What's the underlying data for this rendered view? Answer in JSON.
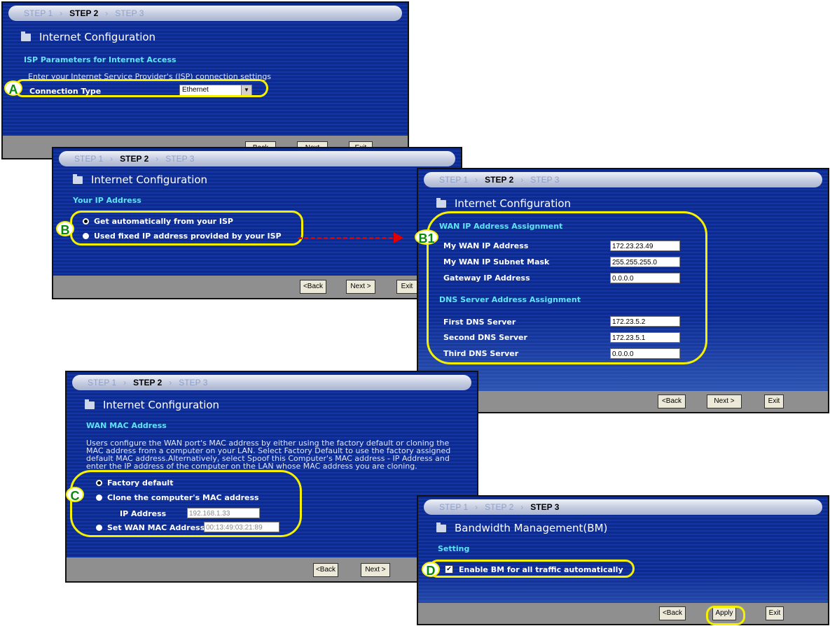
{
  "panel_a": {
    "steps": [
      "STEP 1",
      "STEP 2",
      "STEP 3"
    ],
    "title": "Internet Configuration",
    "section": "ISP Parameters for Internet Access",
    "intro": "Enter your Internet Service Provider's (ISP) connection settings",
    "connection_type_label": "Connection Type",
    "connection_type_value": "Ethernet",
    "buttons": [
      "Back",
      "Next",
      "Exit"
    ],
    "badge": "A"
  },
  "panel_b": {
    "steps": [
      "STEP 1",
      "STEP 2",
      "STEP 3"
    ],
    "title": "Internet Configuration",
    "section": "Your IP Address",
    "option_auto": "Get automatically from your ISP",
    "option_fixed": "Used fixed IP address provided by your ISP",
    "selected": "option_auto",
    "buttons": [
      "<Back",
      "Next >",
      "Exit"
    ],
    "badge": "B"
  },
  "panel_b1": {
    "steps": [
      "STEP 1",
      "STEP 2",
      "STEP 3"
    ],
    "title": "Internet Configuration",
    "wan_section": "WAN IP Address Assignment",
    "fields": [
      {
        "label": "My WAN IP Address",
        "value": "172.23.23.49"
      },
      {
        "label": "My WAN IP Subnet Mask",
        "value": "255.255.255.0"
      },
      {
        "label": "Gateway IP Address",
        "value": "0.0.0.0"
      }
    ],
    "dns_section": "DNS Server Address Assignment",
    "dns_fields": [
      {
        "label": "First DNS Server",
        "value": "172.23.5.2"
      },
      {
        "label": "Second DNS Server",
        "value": "172.23.5.1"
      },
      {
        "label": "Third DNS Server",
        "value": "0.0.0.0"
      }
    ],
    "buttons": [
      "<Back",
      "Next >",
      "Exit"
    ],
    "badge": "B1"
  },
  "panel_c": {
    "steps": [
      "STEP 1",
      "STEP 2",
      "STEP 3"
    ],
    "title": "Internet Configuration",
    "section": "WAN MAC Address",
    "description": [
      "Users configure the WAN port's MAC address by either using the factory default or cloning the",
      "MAC address from a computer on your LAN. Select Factory Default to use the factory assigned",
      "default MAC address.Alternatively, select Spoof this Computer's MAC address - IP Address and",
      "enter the IP address of the computer on the LAN whose MAC address you are cloning."
    ],
    "option_factory": "Factory default",
    "option_clone": "Clone the computer's MAC address",
    "ip_label": "IP Address",
    "ip_value": "192.168.1.33",
    "option_set": "Set WAN MAC Address",
    "mac_value": "00:13:49:03:21:89",
    "selected": "option_factory",
    "buttons": [
      "<Back",
      "Next >"
    ],
    "badge": "C"
  },
  "panel_d": {
    "steps": [
      "STEP 1",
      "STEP 2",
      "STEP 3"
    ],
    "title": "Bandwidth Management(BM)",
    "section": "Setting",
    "checkbox_label": "Enable BM for all traffic automatically",
    "checkbox_checked": true,
    "checkbox_mark": "✔",
    "buttons": [
      "<Back",
      "Apply",
      "Exit"
    ],
    "badge": "D"
  },
  "icons": {
    "dropdown": "▼"
  },
  "colors": {
    "highlight": "#f5f000",
    "badge_text": "#0a8a0a",
    "arrow": "#e00000",
    "section": "#5fe4f5"
  }
}
